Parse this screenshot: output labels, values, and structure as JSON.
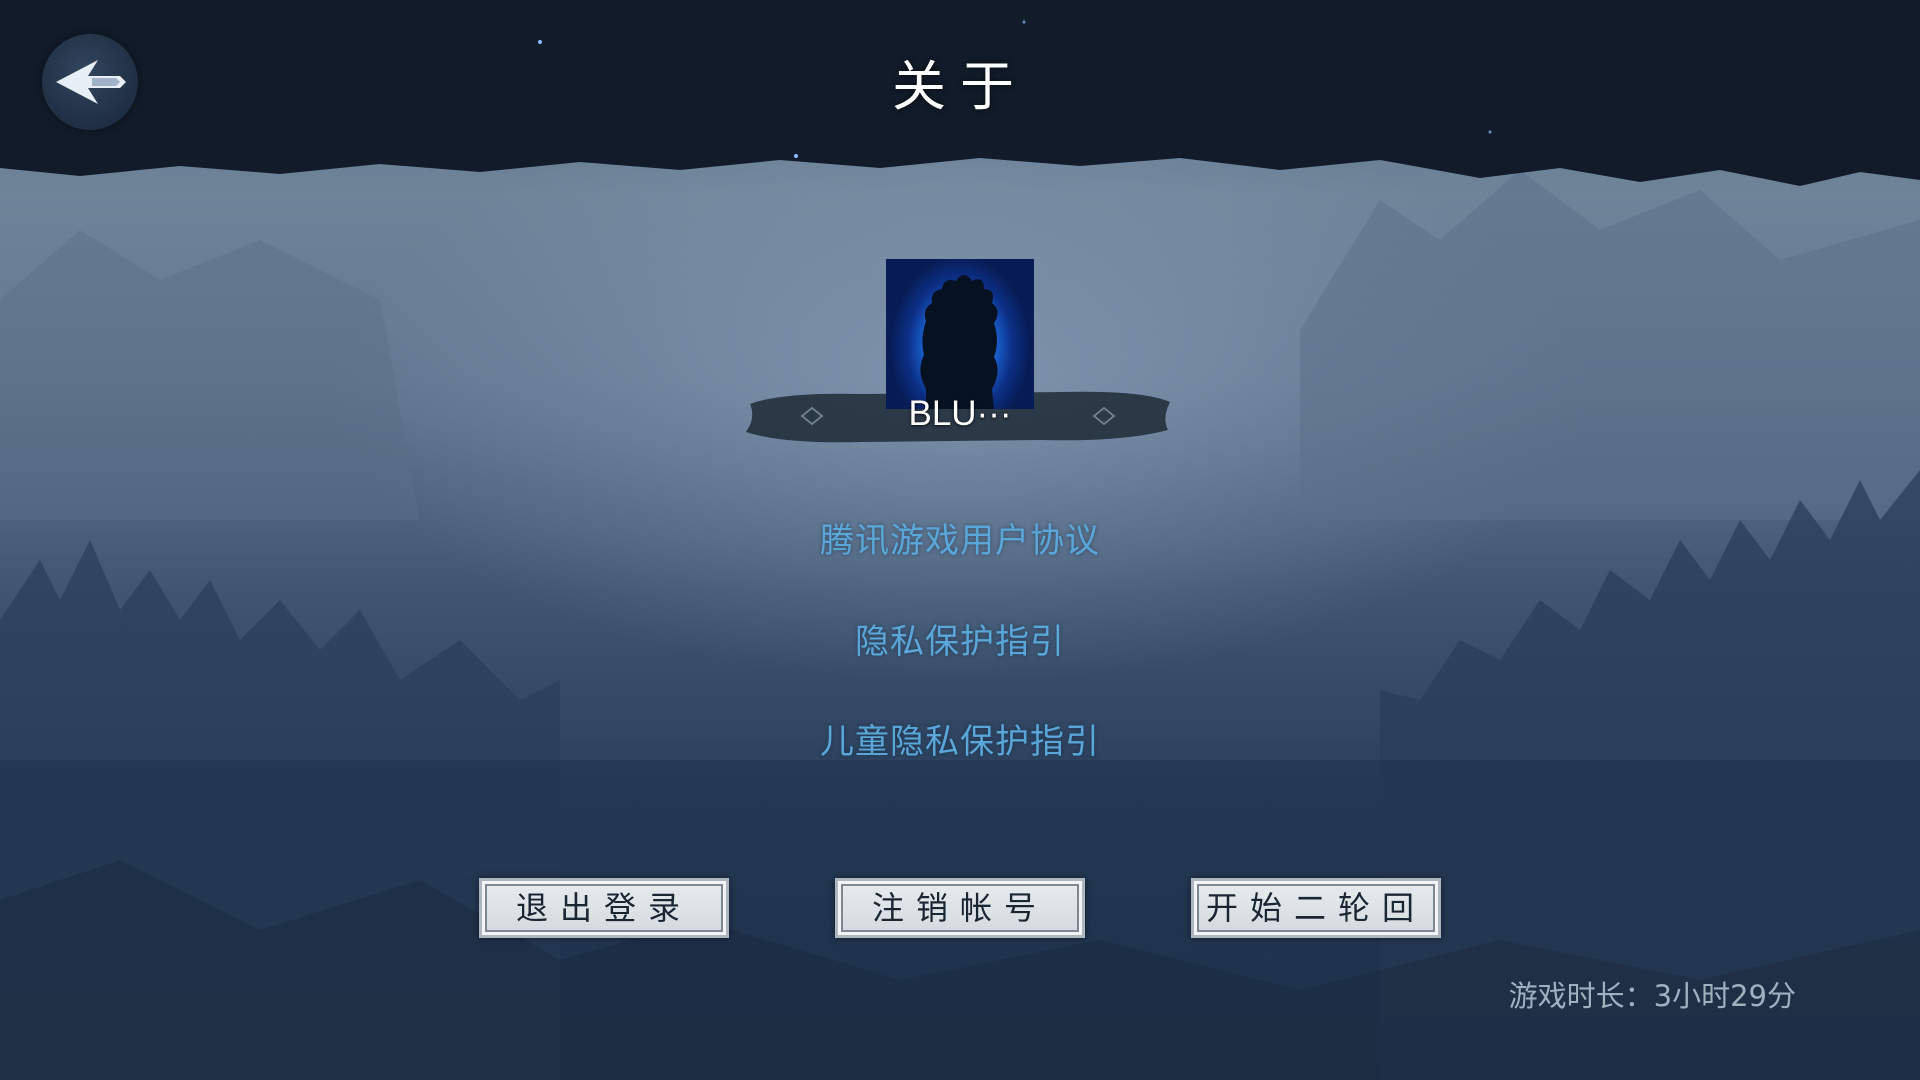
{
  "header": {
    "title": "关于",
    "back_icon": "back-arrow-icon"
  },
  "profile": {
    "avatar_icon": "player-silhouette-avatar",
    "name": "BLU···"
  },
  "links": [
    {
      "label": "腾讯游戏用户协议"
    },
    {
      "label": "隐私保护指引"
    },
    {
      "label": "儿童隐私保护指引"
    }
  ],
  "actions": {
    "logout_label": "退出登录",
    "cancel_account_label": "注销帐号",
    "new_cycle_label": "开始二轮回"
  },
  "footer": {
    "playtime": "游戏时长：3小时29分"
  },
  "colors": {
    "link": "#5aa6d8",
    "title": "#ffffff",
    "button_face": "#e8ecef",
    "background": "#3f5673"
  }
}
